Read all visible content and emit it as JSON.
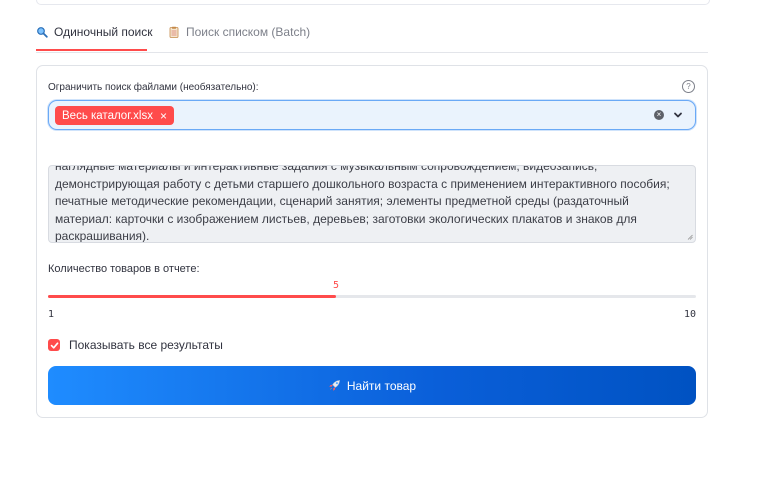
{
  "tabs": [
    {
      "label": "Одиночный поиск",
      "icon": "magnifier-icon",
      "active": true
    },
    {
      "label": "Поиск списком (Batch)",
      "icon": "clipboard-icon",
      "active": false
    }
  ],
  "filter": {
    "label": "Ограничить поиск файлами (необязательно):",
    "help": "?",
    "selected": [
      {
        "label": "Весь каталог.xlsx",
        "remove": "×"
      }
    ],
    "clear": "×"
  },
  "query": {
    "text": "наглядные материалы и интерактивные задания с музыкальным сопровождением, видеозапись, демонстрирующая работу с детьми старшего дошкольного возраста с применением интерактивного пособия; печатные методические рекомендации, сценарий занятия; элементы предметной среды (раздаточный материал: карточки с изображением листьев, деревьев; заготовки экологических плакатов и знаков для раскрашивания)."
  },
  "slider": {
    "label": "Количество товаров в отчете:",
    "value": 5,
    "value_label": "5",
    "min": 1,
    "max": 10,
    "min_label": "1",
    "max_label": "10"
  },
  "show_all": {
    "label": "Показывать все результаты",
    "checked": true
  },
  "search_button": {
    "label": "Найти товар",
    "icon": "rocket-icon"
  },
  "colors": {
    "accent": "#ff4b4b",
    "button_start": "#1f8cff",
    "button_end": "#0052c2"
  }
}
